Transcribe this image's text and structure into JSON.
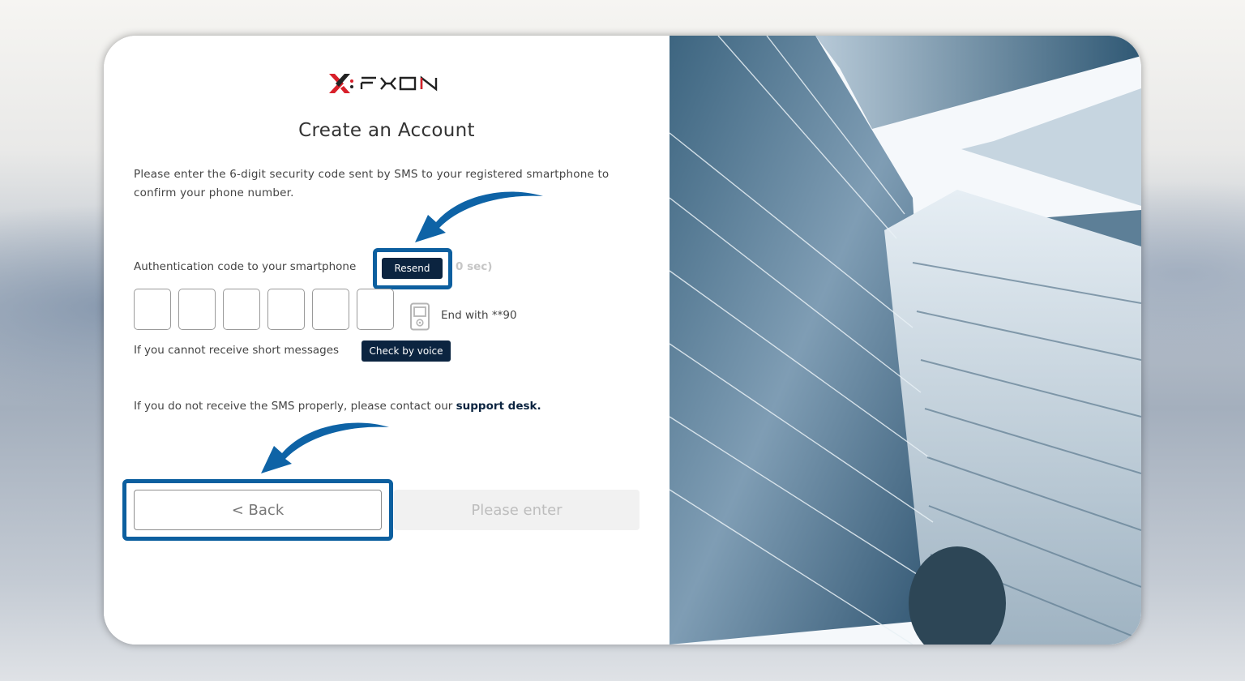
{
  "brand": {
    "name": "FXON",
    "accent_red": "#d8202a",
    "dark": "#222222"
  },
  "page": {
    "title": "Create an Account",
    "description": "Please enter the 6-digit security code sent by SMS to your registered smartphone to confirm your phone number."
  },
  "auth": {
    "label": "Authentication code to your smartphone",
    "resend_label": "Resend",
    "timer_text": "0 sec)",
    "code_boxes": [
      "",
      "",
      "",
      "",
      "",
      ""
    ],
    "phone_icon": "mobile-phone-icon",
    "phone_hint": "End with **90"
  },
  "voice": {
    "label": "If you cannot receive short messages",
    "button_label": "Check by voice"
  },
  "support": {
    "text": "If you do not receive the SMS properly, please contact our ",
    "link_label": "support desk."
  },
  "actions": {
    "back_label": "< Back",
    "submit_label": "Please enter"
  },
  "annotations": {
    "highlight_color": "#0c5f9f",
    "arrow_color": "#0e63a6"
  },
  "colors": {
    "button_dark": "#0b2440",
    "disabled_bg": "#f1f1f1"
  }
}
